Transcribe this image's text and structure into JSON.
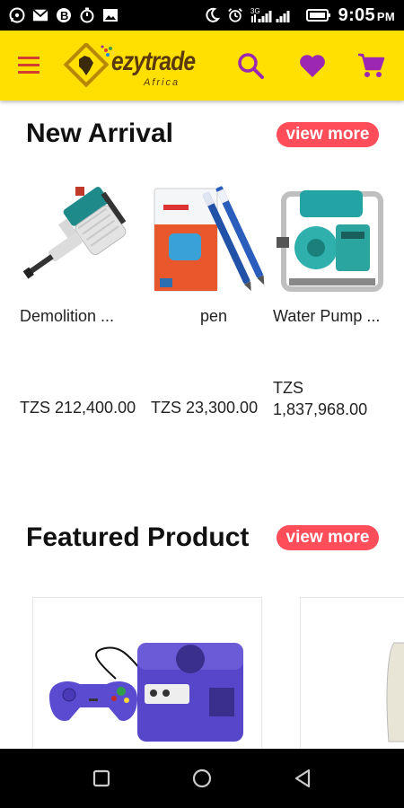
{
  "status_bar": {
    "time": "9:05",
    "ampm": "PM",
    "network": "3G",
    "icons": [
      "whatsapp-icon",
      "gmail-icon",
      "bitcoin-icon",
      "stopwatch-icon",
      "image-icon",
      "moon-icon",
      "alarm-icon",
      "signal-icon",
      "battery-icon"
    ]
  },
  "app_bar": {
    "logo_text": "ezytrade",
    "logo_sub": "Africa",
    "icons": [
      "menu-icon",
      "search-icon",
      "heart-icon",
      "cart-icon"
    ],
    "colors": {
      "background": "#ffe000",
      "icon": "#9c27b0",
      "menu": "#d23f2e"
    }
  },
  "new_arrival": {
    "title": "New Arrival",
    "view_more": "view more",
    "products": [
      {
        "name": "Demolition ...",
        "price": "TZS 212,400.00"
      },
      {
        "name": "pen",
        "price": "TZS 23,300.00"
      },
      {
        "name": "Water Pump ...",
        "price": "TZS 1,837,968.00"
      }
    ]
  },
  "featured": {
    "title": "Featured Product",
    "view_more": "view more"
  },
  "accent_color": "#ff4d5a"
}
